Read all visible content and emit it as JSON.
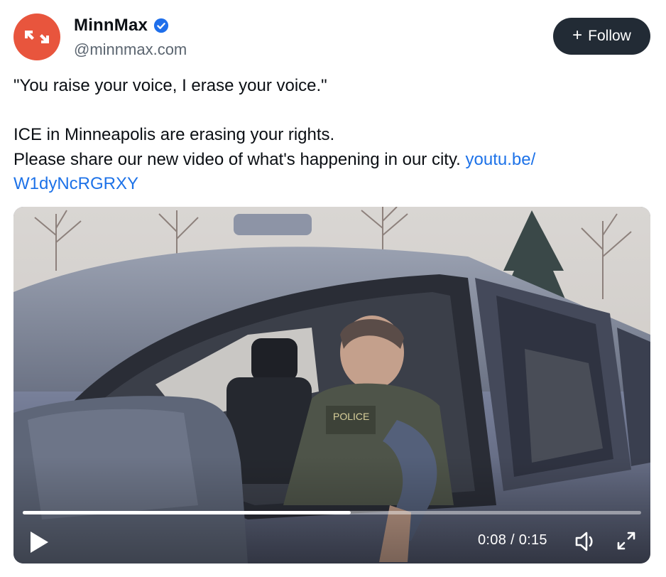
{
  "author": {
    "display_name": "MinnMax",
    "handle": "@minnmax.com",
    "verified": true,
    "avatar_color": "#e8553d"
  },
  "follow_button": {
    "label": "Follow",
    "icon": "plus-icon"
  },
  "post": {
    "line1": "\"You raise your voice, I erase your voice.\"",
    "line2": "ICE in Minneapolis are erasing your rights.",
    "line3": "Please share our new video of what's happening in our city.",
    "link_line1": "youtu.be/",
    "link_line2": "W1dyNcRGRXY",
    "link_color": "#1d72e8"
  },
  "video": {
    "current_time": "0:08",
    "separator": " / ",
    "duration": "0:15",
    "progress": 0.53,
    "controls": [
      "play-icon",
      "volume-icon",
      "fullscreen-icon"
    ]
  }
}
